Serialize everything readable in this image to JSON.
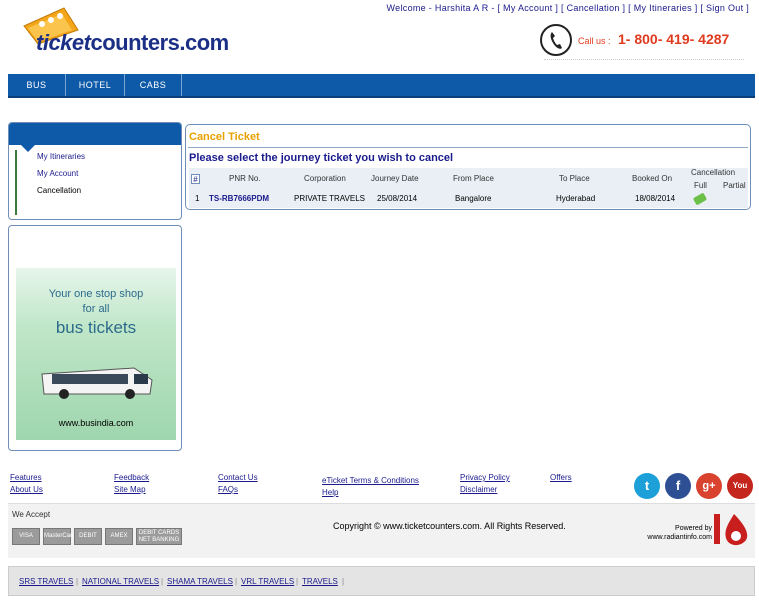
{
  "brand": {
    "logo_text_ticket": "ticket",
    "logo_text_rest": "counters.com"
  },
  "header": {
    "welcome_prefix": "Welcome - Harshita A R -",
    "links": [
      "[ My Account ]",
      "[ Cancellation ]",
      "[ My Itineraries ]",
      "[ Sign Out ]"
    ],
    "call_label": "Call us :",
    "call_number": "1- 800- 419- 4287"
  },
  "nav": {
    "items": [
      "BUS",
      "HOTEL",
      "CABS"
    ]
  },
  "sidebar": {
    "items": [
      {
        "label": "My Itineraries",
        "current": false
      },
      {
        "label": "My Account",
        "current": false
      },
      {
        "label": "Cancellation",
        "current": true
      }
    ]
  },
  "promo": {
    "line1": "Your one stop shop",
    "line2": "for all",
    "line3": "bus tickets",
    "url": "www.busindia.com"
  },
  "main": {
    "title": "Cancel Ticket",
    "subtitle": "Please select the journey ticket you wish to cancel",
    "table": {
      "headers": {
        "hash": "#",
        "pnr": "PNR No.",
        "corporation": "Corporation",
        "journey_date": "Journey Date",
        "from_place": "From Place",
        "to_place": "To Place",
        "booked_on": "Booked On",
        "cancellation": "Cancellation",
        "full": "Full",
        "partial": "Partial"
      },
      "rows": [
        {
          "index": "1",
          "pnr": "TS-RB7666PDM",
          "corporation": "PRIVATE TRAVELS",
          "journey_date": "25/08/2014",
          "from_place": "Bangalore",
          "to_place": "Hyderabad",
          "booked_on": "18/08/2014"
        }
      ]
    }
  },
  "footer": {
    "links": {
      "features": "Features",
      "about_us": "About Us",
      "feedback": "Feedback",
      "site_map": "Site Map",
      "contact_us": "Contact Us",
      "faqs": "FAQs",
      "eticket_terms": "eTicket Terms & Conditions",
      "help": "Help",
      "privacy_policy": "Privacy Policy",
      "disclaimer": "Disclaimer",
      "offers": "Offers"
    },
    "social": {
      "twitter": "t",
      "facebook": "f",
      "googleplus": "g+",
      "youtube": "You"
    },
    "we_accept": "We Accept",
    "cards": [
      "VISA",
      "MasterCard",
      "DEBIT",
      "AMEX",
      "DEBIT CARDS NET BANKING"
    ],
    "copyright": "Copyright © www.ticketcounters.com. All Rights Reserved.",
    "powered_by": "Powered by",
    "powered_url": "www.radiantinfo.com",
    "operators": [
      "SRS TRAVELS",
      "NATIONAL TRAVELS",
      "SHAMA TRAVELS",
      "VRL TRAVELS",
      "TRAVELS"
    ]
  },
  "colors": {
    "nav_blue": "#0e5aa8",
    "title_orange": "#e8a000",
    "link_blue": "#1a1a8c",
    "call_red": "#e03a1e"
  }
}
